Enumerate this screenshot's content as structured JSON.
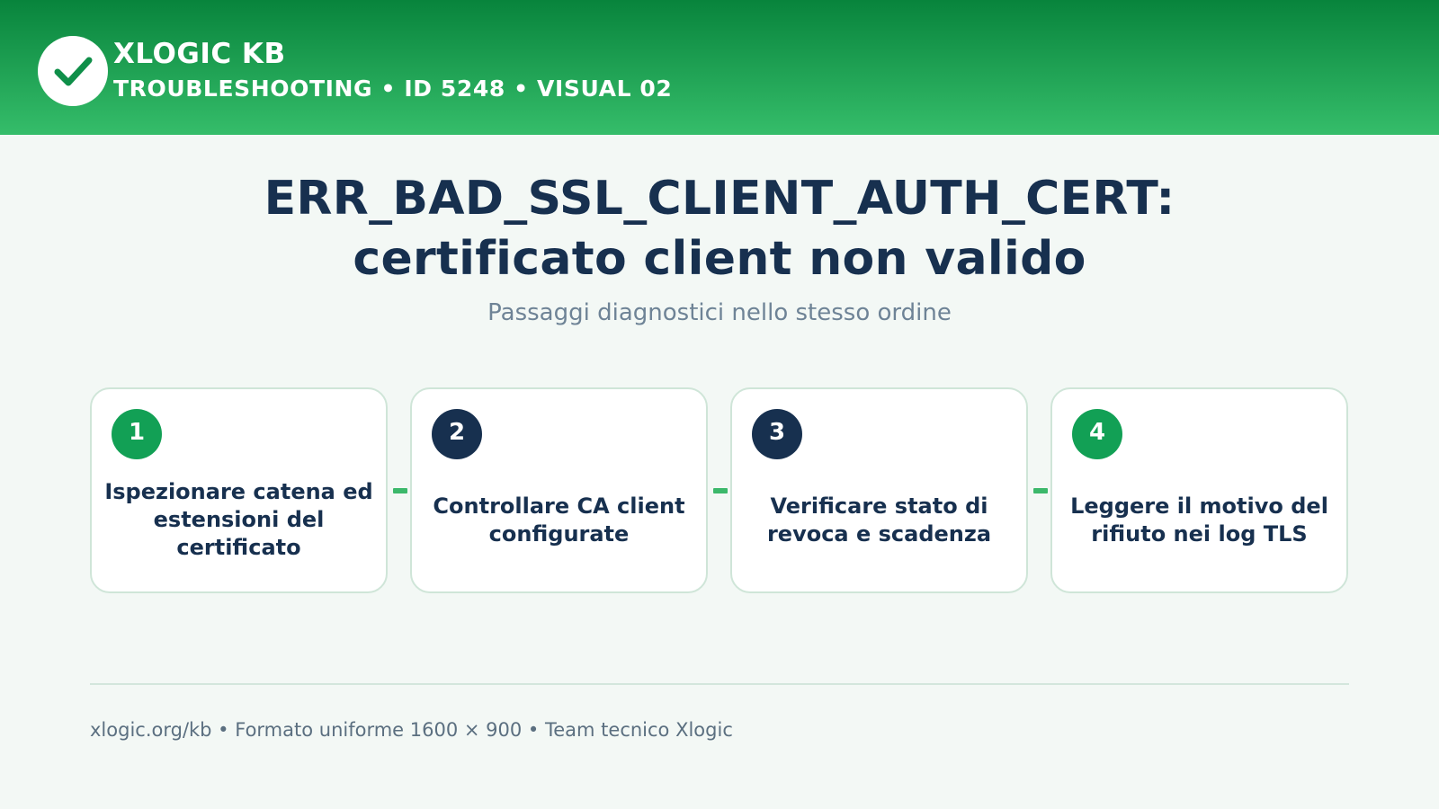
{
  "header": {
    "brand_title": "XLOGIC KB",
    "brand_subtitle": "TROUBLESHOOTING • ID 5248 • VISUAL 02",
    "logo_icon": "checkmark-icon"
  },
  "main": {
    "title_line1": "ERR_BAD_SSL_CLIENT_AUTH_CERT:",
    "title_line2": "certificato client non valido",
    "subtitle": "Passaggi diagnostici nello stesso ordine"
  },
  "steps": [
    {
      "number": "1",
      "text": "Ispezionare catena ed estensioni del certificato",
      "badge_color": "#12a055"
    },
    {
      "number": "2",
      "text": "Controllare CA client configurate",
      "badge_color": "#17304f"
    },
    {
      "number": "3",
      "text": "Verificare stato di revoca e scadenza",
      "badge_color": "#17304f"
    },
    {
      "number": "4",
      "text": "Leggere il motivo del rifiuto nei log TLS",
      "badge_color": "#12a055"
    }
  ],
  "footer": {
    "text": "xlogic.org/kb • Formato uniforme 1600 × 900 • Team tecnico Xlogic"
  },
  "colors": {
    "header_dark": "#08843c",
    "header_light": "#35bd6a",
    "accent_green": "#12a055",
    "navy": "#17304f",
    "background": "#f3f8f5"
  }
}
